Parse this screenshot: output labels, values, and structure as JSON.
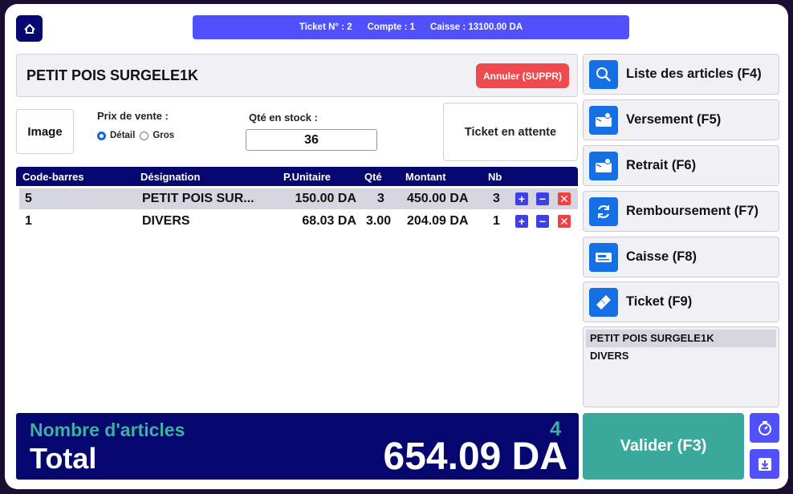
{
  "top_banner": {
    "ticket": "Ticket N° : 2",
    "account": "Compte : 1",
    "cash": "Caisse : 13100.00 DA"
  },
  "product": {
    "name": "PETIT POIS SURGELE1K",
    "cancel_label": "Annuler (SUPPR)"
  },
  "image_label": "Image",
  "price": {
    "label": "Prix de vente :",
    "options": [
      "Détail",
      "Gros"
    ],
    "selected": "Détail"
  },
  "stock": {
    "label": "Qté en stock :",
    "value": "36"
  },
  "waiting_label": "Ticket en attente",
  "table": {
    "headers": [
      "Code-barres",
      "Désignation",
      "P.Unitaire",
      "Qté",
      "Montant",
      "Nb"
    ],
    "rows": [
      {
        "code": "5",
        "designation": "PETIT POIS SUR...",
        "unit_price": "150.00 DA",
        "qty": "3",
        "amount": "450.00 DA",
        "nb": "3"
      },
      {
        "code": "1",
        "designation": "DIVERS",
        "unit_price": "68.03 DA",
        "qty": "3.00",
        "amount": "204.09 DA",
        "nb": "1"
      }
    ],
    "actions": {
      "plus": "+",
      "minus": "−",
      "delete": "✕"
    }
  },
  "sidebar": {
    "buttons": [
      {
        "label": "Liste des articles (F4)",
        "icon": "search-icon"
      },
      {
        "label": "Versement (F5)",
        "icon": "wallet-in-icon"
      },
      {
        "label": "Retrait (F6)",
        "icon": "wallet-out-icon"
      },
      {
        "label": "Remboursement (F7)",
        "icon": "refresh-icon"
      },
      {
        "label": "Caisse (F8)",
        "icon": "cash-register-icon"
      },
      {
        "label": "Ticket (F9)",
        "icon": "ticket-icon"
      }
    ],
    "list_items": [
      "PETIT POIS SURGELE1K",
      "DIVERS"
    ]
  },
  "totals": {
    "count_label": "Nombre d'articles",
    "count_value": "4",
    "total_label": "Total",
    "total_value": "654.09 DA"
  },
  "validate_label": "Valider (F3)",
  "colors": {
    "navy": "#05066e",
    "accent_blue": "#5050ff",
    "icon_blue": "#1570e6",
    "teal": "#3aa89a",
    "danger": "#f04a4f"
  }
}
